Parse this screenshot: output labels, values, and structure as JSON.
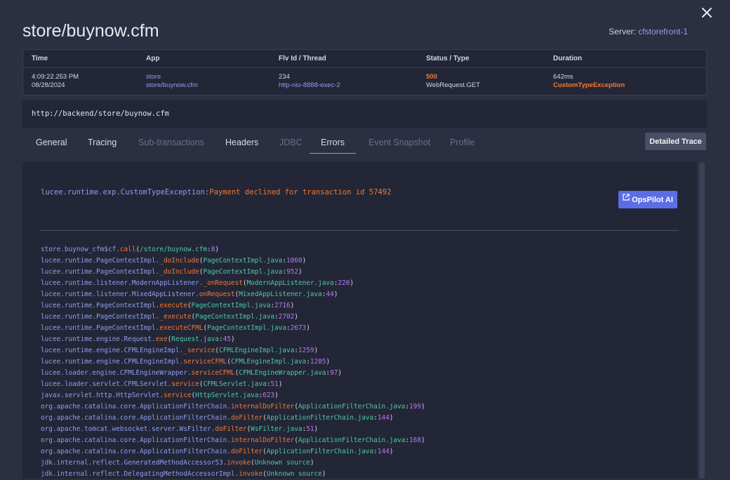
{
  "page": {
    "title": "store/buynow.cfm",
    "server_label": "Server:",
    "server_value": "cfstorefront-1",
    "close_icon": "close-icon"
  },
  "summary": {
    "headers": [
      "Time",
      "App",
      "Flv Id / Thread",
      "Status / Type",
      "Duration"
    ],
    "time": "4:09:22.253 PM",
    "date": "08/28/2024",
    "app": "store",
    "app_path": "store/buynow.cfm",
    "flv_id": "234",
    "thread": "http-nio-8888-exec-2",
    "status": "500",
    "type": "WebRequest.GET",
    "duration": "642ms",
    "exception_type": "CustomTypeException"
  },
  "url": "http://backend/store/buynow.cfm",
  "tabs": [
    {
      "label": "General",
      "state": "enabled"
    },
    {
      "label": "Tracing",
      "state": "enabled"
    },
    {
      "label": "Sub-transactions",
      "state": "disabled"
    },
    {
      "label": "Headers",
      "state": "enabled"
    },
    {
      "label": "JDBC",
      "state": "disabled"
    },
    {
      "label": "Errors",
      "state": "active"
    },
    {
      "label": "Event Snapshot",
      "state": "disabled"
    },
    {
      "label": "Profile",
      "state": "disabled"
    }
  ],
  "detailed_trace_label": "Detailed Trace",
  "error": {
    "exception_class": "lucee.runtime.exp.CustomTypeException:",
    "message": "Payment declined for transaction id 57492",
    "opspilot_label": "OpsPilot AI",
    "opspilot_icon": "external-link-icon"
  },
  "colors": {
    "accent": "#8f9ff0",
    "error": "#f07a3a",
    "file": "#4fc9a5",
    "line_number": "#b57af2",
    "button": "#5b6ee6"
  },
  "stack_trace": [
    {
      "cls": "store.buynow_cfm$cf.",
      "method": "call",
      "file": "/store/buynow.cfm",
      "line": "8"
    },
    {
      "cls": "lucee.runtime.PageContextImpl.",
      "method": "_doInclude",
      "file": "PageContextImpl.java",
      "line": "1060"
    },
    {
      "cls": "lucee.runtime.PageContextImpl.",
      "method": "_doInclude",
      "file": "PageContextImpl.java",
      "line": "952"
    },
    {
      "cls": "lucee.runtime.listener.ModernAppListener.",
      "method": "_onRequest",
      "file": "ModernAppListener.java",
      "line": "220"
    },
    {
      "cls": "lucee.runtime.listener.MixedAppListener.",
      "method": "onRequest",
      "file": "MixedAppListener.java",
      "line": "44"
    },
    {
      "cls": "lucee.runtime.PageContextImpl.",
      "method": "execute",
      "file": "PageContextImpl.java",
      "line": "2716"
    },
    {
      "cls": "lucee.runtime.PageContextImpl.",
      "method": "_execute",
      "file": "PageContextImpl.java",
      "line": "2702"
    },
    {
      "cls": "lucee.runtime.PageContextImpl.",
      "method": "executeCFML",
      "file": "PageContextImpl.java",
      "line": "2673"
    },
    {
      "cls": "lucee.runtime.engine.Request.",
      "method": "exe",
      "file": "Request.java",
      "line": "45"
    },
    {
      "cls": "lucee.runtime.engine.CFMLEngineImpl.",
      "method": "_service",
      "file": "CFMLEngineImpl.java",
      "line": "1259"
    },
    {
      "cls": "lucee.runtime.engine.CFMLEngineImpl.",
      "method": "serviceCFML",
      "file": "CFMLEngineImpl.java",
      "line": "1205"
    },
    {
      "cls": "lucee.loader.engine.CFMLEngineWrapper.",
      "method": "serviceCFML",
      "file": "CFMLEngineWrapper.java",
      "line": "97"
    },
    {
      "cls": "lucee.loader.servlet.CFMLServlet.",
      "method": "service",
      "file": "CFMLServlet.java",
      "line": "51"
    },
    {
      "cls": "javax.servlet.http.HttpServlet.",
      "method": "service",
      "file": "HttpServlet.java",
      "line": "623"
    },
    {
      "cls": "org.apache.catalina.core.ApplicationFilterChain.",
      "method": "internalDoFilter",
      "file": "ApplicationFilterChain.java",
      "line": "199"
    },
    {
      "cls": "org.apache.catalina.core.ApplicationFilterChain.",
      "method": "doFilter",
      "file": "ApplicationFilterChain.java",
      "line": "144"
    },
    {
      "cls": "org.apache.tomcat.websocket.server.WsFilter.",
      "method": "doFilter",
      "file": "WsFilter.java",
      "line": "51"
    },
    {
      "cls": "org.apache.catalina.core.ApplicationFilterChain.",
      "method": "internalDoFilter",
      "file": "ApplicationFilterChain.java",
      "line": "168"
    },
    {
      "cls": "org.apache.catalina.core.ApplicationFilterChain.",
      "method": "doFilter",
      "file": "ApplicationFilterChain.java",
      "line": "144"
    },
    {
      "cls": "jdk.internal.reflect.GeneratedMethodAccessor53.",
      "method": "invoke",
      "file": "Unknown source",
      "line": ""
    },
    {
      "cls": "jdk.internal.reflect.DelegatingMethodAccessorImpl.",
      "method": "invoke",
      "file": "Unknown source",
      "line": ""
    }
  ]
}
